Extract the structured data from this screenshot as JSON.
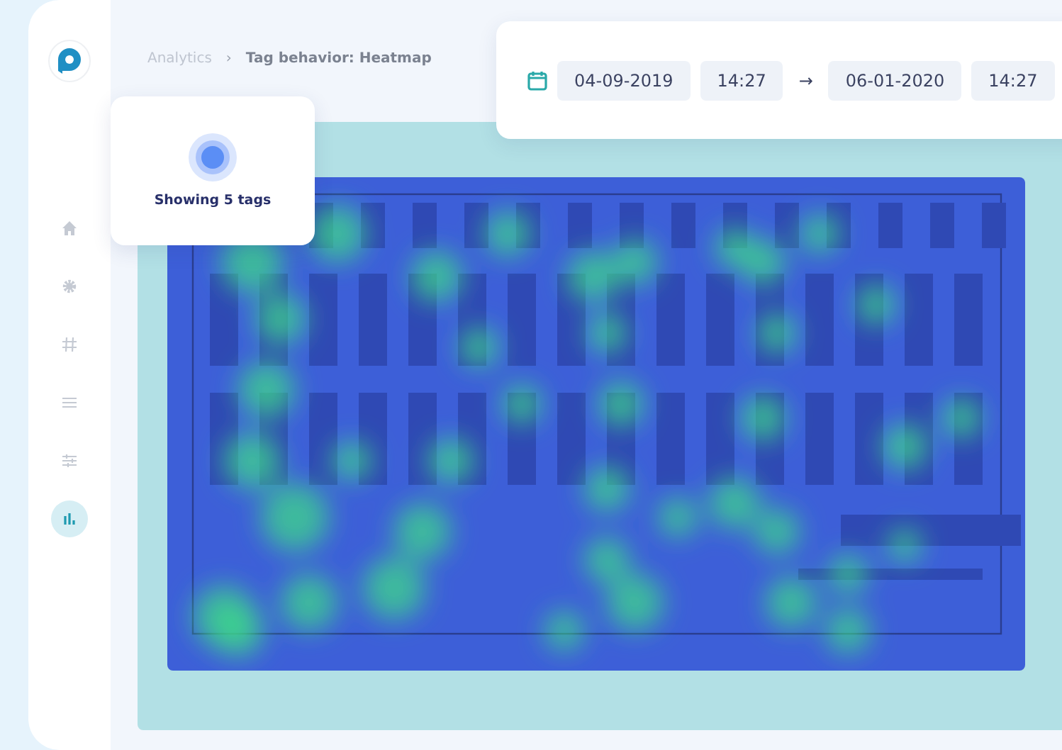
{
  "sidebar": {
    "items": [
      {
        "kind": "home",
        "selected": false
      },
      {
        "kind": "settings",
        "selected": false
      },
      {
        "kind": "hash",
        "selected": false
      },
      {
        "kind": "list",
        "selected": false
      },
      {
        "kind": "sliders",
        "selected": false
      },
      {
        "kind": "chart",
        "selected": true
      }
    ]
  },
  "breadcrumb": {
    "items": [
      "Analytics",
      "Tag behavior: Heatmap"
    ],
    "separator": "›"
  },
  "tags_card": {
    "label": "Showing 5 tags"
  },
  "date_range": {
    "start_date": "04-09-2019",
    "start_time": "14:27",
    "arrow": "→",
    "end_date": "06-01-2020",
    "end_time": "14:27"
  }
}
